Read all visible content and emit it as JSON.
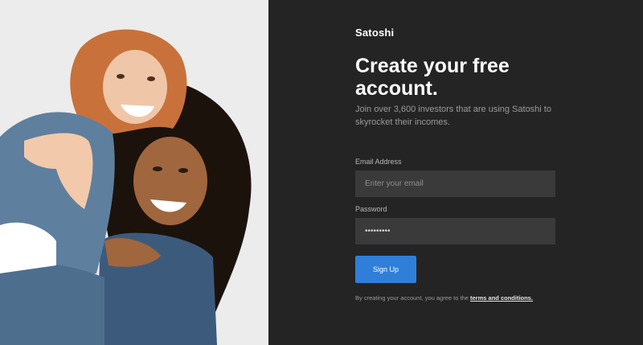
{
  "photo": {
    "alt": "Two smiling girls, one riding piggyback"
  },
  "brand": {
    "name": "Satoshi"
  },
  "heading": {
    "title": "Create your free account.",
    "subtitle": "Join over 3,600 investors that are using Satoshi to skyrocket their incomes."
  },
  "form": {
    "email_label": "Email Address",
    "email_placeholder": "Enter your email",
    "password_label": "Password",
    "password_value": "•••••••••",
    "submit_label": "Sign Up"
  },
  "terms": {
    "prefix": "By creating your account, you agree to the ",
    "link": "terms and conditions."
  },
  "colors": {
    "background": "#242424",
    "input": "#3a3a3a",
    "button": "#2f7fd8"
  }
}
